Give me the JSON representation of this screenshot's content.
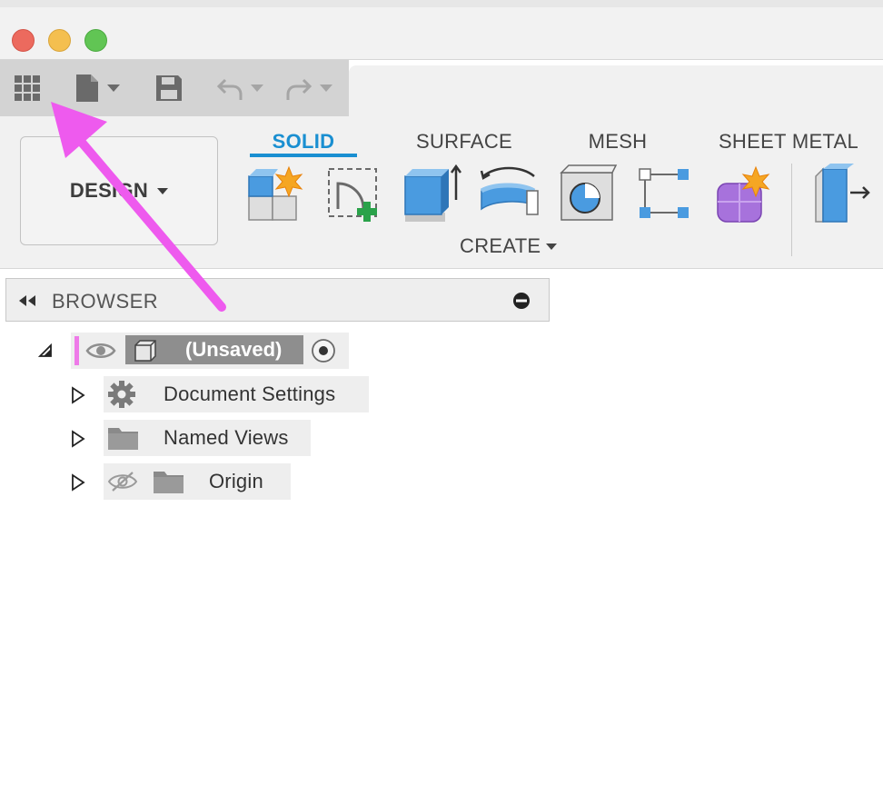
{
  "window": {
    "traffic_lights": [
      "close",
      "minimize",
      "zoom"
    ]
  },
  "quick_access": {
    "icons": [
      "grid-icon",
      "file-icon",
      "save-icon",
      "undo-icon",
      "redo-icon"
    ]
  },
  "ribbon": {
    "workspace_label": "DESIGN",
    "tabs": [
      {
        "label": "SOLID",
        "active": true
      },
      {
        "label": "SURFACE",
        "active": false
      },
      {
        "label": "MESH",
        "active": false
      },
      {
        "label": "SHEET METAL",
        "active": false
      }
    ],
    "create_label": "CREATE",
    "tools": [
      "new-component-icon",
      "create-sketch-icon",
      "extrude-icon",
      "revolve-icon",
      "hole-icon",
      "pattern-icon",
      "create-form-icon",
      "modify-icon"
    ]
  },
  "browser": {
    "title": "BROWSER",
    "root": {
      "label": "(Unsaved)"
    },
    "children": [
      {
        "label": "Document Settings",
        "icon": "gear-icon"
      },
      {
        "label": "Named Views",
        "icon": "folder-icon"
      },
      {
        "label": "Origin",
        "icon": "folder-icon"
      }
    ]
  },
  "colors": {
    "accent": "#1a8fd1",
    "annotation_arrow": "#ee5aee"
  }
}
